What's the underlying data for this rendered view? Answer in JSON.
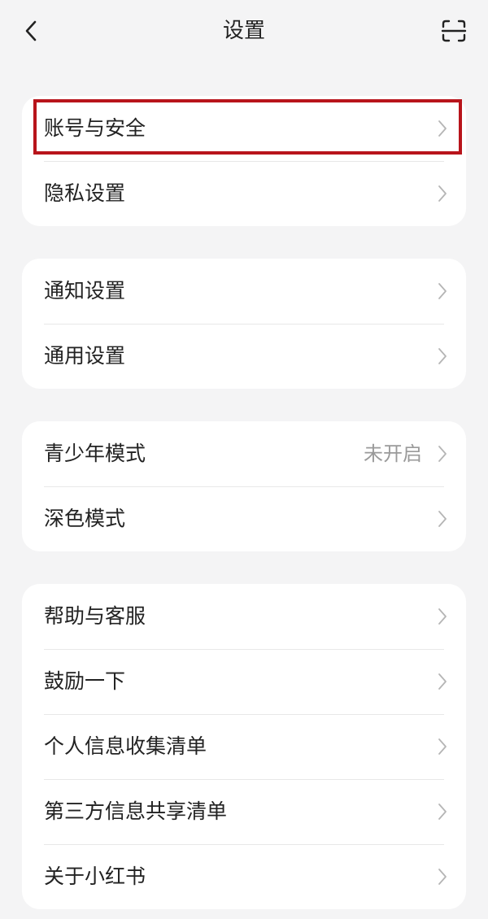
{
  "header": {
    "title": "设置",
    "back_icon": "chevron-left-icon",
    "scan_icon": "scan-icon"
  },
  "groups": [
    {
      "items": [
        {
          "label": "账号与安全"
        },
        {
          "label": "隐私设置"
        }
      ]
    },
    {
      "items": [
        {
          "label": "通知设置"
        },
        {
          "label": "通用设置"
        }
      ]
    },
    {
      "items": [
        {
          "label": "青少年模式",
          "value": "未开启"
        },
        {
          "label": "深色模式"
        }
      ]
    },
    {
      "items": [
        {
          "label": "帮助与客服"
        },
        {
          "label": "鼓励一下"
        },
        {
          "label": "个人信息收集清单"
        },
        {
          "label": "第三方信息共享清单"
        },
        {
          "label": "关于小红书"
        }
      ]
    }
  ],
  "colors": {
    "background": "#f4f4f5",
    "card": "#ffffff",
    "highlight": "#b8141b",
    "secondary_text": "#9a9a9a"
  }
}
